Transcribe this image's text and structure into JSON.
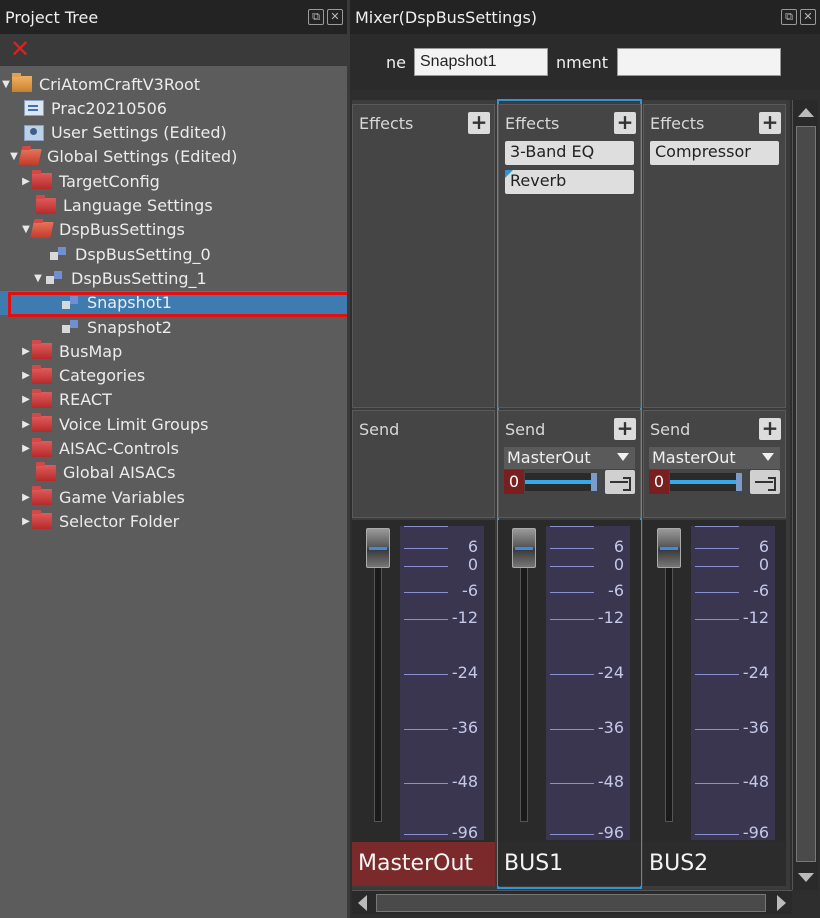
{
  "project_tree": {
    "title": "Project Tree",
    "items": [
      {
        "label": "CriAtomCraftV3Root",
        "icon": "folder-open-orange-icon",
        "caret": "▼"
      },
      {
        "label": "Prac20210506",
        "icon": "work-unit-icon",
        "caret": ""
      },
      {
        "label": "User Settings (Edited)",
        "icon": "user-settings-icon",
        "caret": ""
      },
      {
        "label": "Global Settings (Edited)",
        "icon": "folder-open-red-icon",
        "caret": "▼"
      },
      {
        "label": "TargetConfig",
        "icon": "folder-red-icon",
        "caret": "▶"
      },
      {
        "label": "Language Settings",
        "icon": "folder-red-icon",
        "caret": ""
      },
      {
        "label": "DspBusSettings",
        "icon": "folder-open-red-icon",
        "caret": "▼"
      },
      {
        "label": "DspBusSetting_0",
        "icon": "dsp-bus-icon",
        "caret": ""
      },
      {
        "label": "DspBusSetting_1",
        "icon": "dsp-bus-icon",
        "caret": "▼"
      },
      {
        "label": "Snapshot1",
        "icon": "snapshot-icon",
        "caret": ""
      },
      {
        "label": "Snapshot2",
        "icon": "snapshot-icon",
        "caret": ""
      },
      {
        "label": "BusMap",
        "icon": "folder-red-icon",
        "caret": "▶"
      },
      {
        "label": "Categories",
        "icon": "folder-red-icon",
        "caret": "▶"
      },
      {
        "label": "REACT",
        "icon": "folder-red-icon",
        "caret": "▶"
      },
      {
        "label": "Voice Limit Groups",
        "icon": "folder-red-icon",
        "caret": "▶"
      },
      {
        "label": "AISAC-Controls",
        "icon": "folder-red-icon",
        "caret": "▶"
      },
      {
        "label": "Global AISACs",
        "icon": "folder-red-icon",
        "caret": ""
      },
      {
        "label": "Game Variables",
        "icon": "folder-red-icon",
        "caret": "▶"
      },
      {
        "label": "Selector Folder",
        "icon": "folder-red-icon",
        "caret": "▶"
      }
    ],
    "selected": "Snapshot1"
  },
  "mixer": {
    "title": "Mixer(DspBusSettings)",
    "name_label": "ne",
    "name_value": "Snapshot1",
    "comment_label": "nment",
    "comment_value": "",
    "section_labels": {
      "effects": "Effects",
      "send": "Send",
      "add": "+"
    },
    "meter_scale": [
      "6",
      "0",
      "-6",
      "-12",
      "-24",
      "-36",
      "-48",
      "-96"
    ],
    "buses": [
      {
        "name": "MasterOut",
        "effects": [],
        "send_target": "",
        "send_level": "",
        "selected": false
      },
      {
        "name": "BUS1",
        "effects": [
          "3-Band EQ",
          "Reverb"
        ],
        "send_target": "MasterOut",
        "send_level": "0",
        "selected": true
      },
      {
        "name": "BUS2",
        "effects": [
          "Compressor"
        ],
        "send_target": "MasterOut",
        "send_level": "0",
        "selected": false
      }
    ]
  },
  "colors": {
    "selection": "#3d7bb0",
    "highlight_outline": "#e01010",
    "accent": "#2f95d8",
    "master_bus": "#7a2a2a"
  }
}
